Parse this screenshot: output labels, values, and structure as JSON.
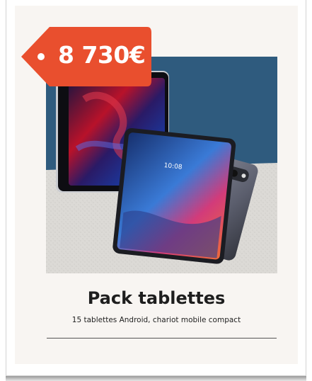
{
  "product": {
    "price": "8 730€",
    "title": "Pack tablettes",
    "subtitle": "15 tablettes Android, chariot mobile compact",
    "image_alt": "Tablettes Android et iPad",
    "tablet_screen_time": "10:08"
  },
  "colors": {
    "price_tag": "#e94f2e",
    "card_background": "#f8f5f2",
    "image_backdrop": "#2f5b7e",
    "image_floor": "#dcdad6"
  }
}
